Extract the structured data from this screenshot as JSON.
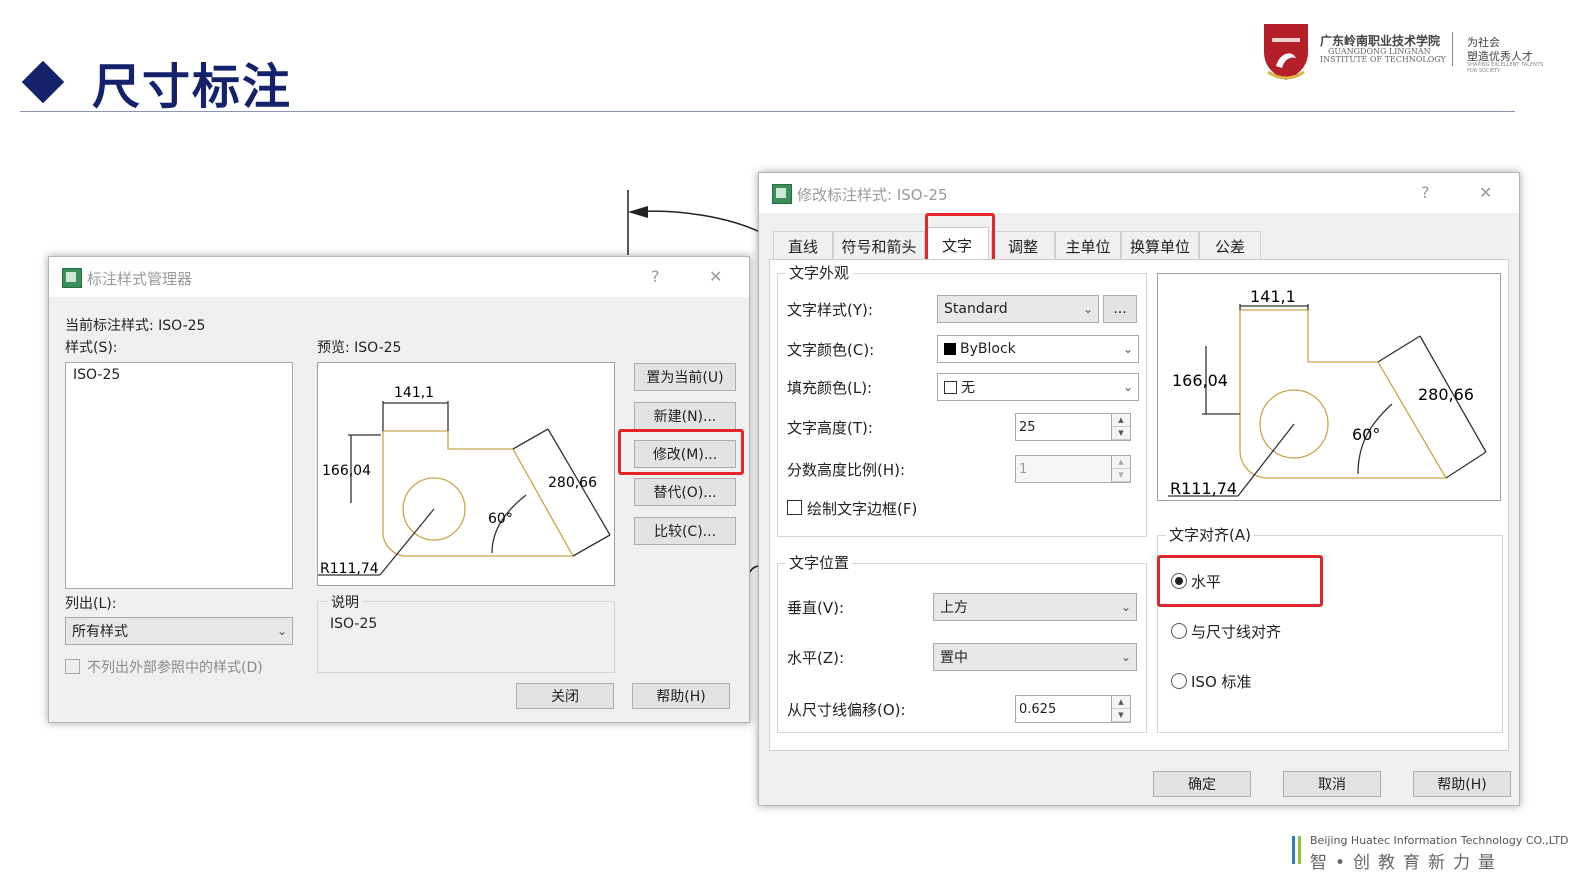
{
  "slide": {
    "title": "尺寸标注",
    "logo": {
      "school_cn": "广东岭南职业技术学院",
      "school_en1": "GUANGDONG LINGNAN",
      "school_en2": "INSTITUTE OF TECHNOLOGY",
      "motto_line1": "为社会",
      "motto_line2": "塑造优秀人才",
      "motto_en": "SHAPING EXCELLENT TALENTS FOR SOCIETY"
    },
    "footer": {
      "company_en": "Beijing Huatec Information Technology CO.,LTD",
      "slogan_cn": "智•创教育新力量"
    }
  },
  "manager_dialog": {
    "title": "标注样式管理器",
    "help_glyph": "?",
    "close_glyph": "✕",
    "current_style_label": "当前标注样式: ISO-25",
    "styles_label": "样式(S):",
    "styles": [
      "ISO-25"
    ],
    "preview_label": "预览: ISO-25",
    "list_label": "列出(L):",
    "list_value": "所有样式",
    "exclude_xref_label": "不列出外部参照中的样式(D)",
    "description_label": "说明",
    "description_value": "ISO-25",
    "buttons": {
      "set_current": "置为当前(U)",
      "new": "新建(N)...",
      "modify": "修改(M)...",
      "override": "替代(O)...",
      "compare": "比较(C)...",
      "close": "关闭",
      "help": "帮助(H)"
    },
    "preview_dims": {
      "top": "141,1",
      "left": "166,04",
      "slant": "280,66",
      "angle": "60°",
      "radius": "R111,74"
    }
  },
  "modify_dialog": {
    "title": "修改标注样式: ISO-25",
    "help_glyph": "?",
    "close_glyph": "✕",
    "tabs": [
      "直线",
      "符号和箭头",
      "文字",
      "调整",
      "主单位",
      "换算单位",
      "公差"
    ],
    "active_tab": "文字",
    "appearance": {
      "group_label": "文字外观",
      "style_label": "文字样式(Y):",
      "style_value": "Standard",
      "more_button": "...",
      "color_label": "文字颜色(C):",
      "color_value": "ByBlock",
      "fill_label": "填充颜色(L):",
      "fill_value": "无",
      "height_label": "文字高度(T):",
      "height_value": "25",
      "fraction_label": "分数高度比例(H):",
      "fraction_value": "1",
      "frame_label": "绘制文字边框(F)"
    },
    "placement": {
      "group_label": "文字位置",
      "vertical_label": "垂直(V):",
      "vertical_value": "上方",
      "horizontal_label": "水平(Z):",
      "horizontal_value": "置中",
      "offset_label": "从尺寸线偏移(O):",
      "offset_value": "0.625"
    },
    "alignment": {
      "group_label": "文字对齐(A)",
      "options": [
        "水平",
        "与尺寸线对齐",
        "ISO 标准"
      ],
      "selected": "水平"
    },
    "preview_dims": {
      "top": "141,1",
      "left": "166,04",
      "slant": "280,66",
      "angle": "60°",
      "radius": "R111,74"
    },
    "buttons": {
      "ok": "确定",
      "cancel": "取消",
      "help": "帮助(H)"
    }
  },
  "colors": {
    "title_blue": "#14216b",
    "highlight_red": "#e3262b",
    "cad_shape": "#c9a64a"
  }
}
